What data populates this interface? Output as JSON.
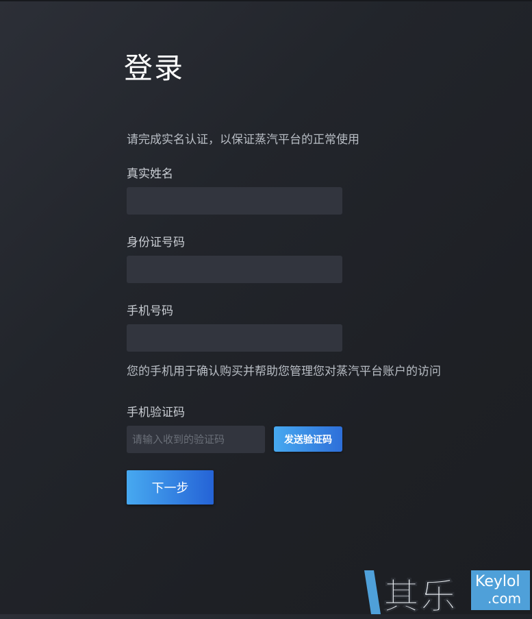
{
  "page": {
    "title": "登录",
    "instruction": "请完成实名认证，以保证蒸汽平台的正常使用"
  },
  "form": {
    "real_name": {
      "label": "真实姓名",
      "value": "",
      "placeholder": ""
    },
    "id_number": {
      "label": "身份证号码",
      "value": "",
      "placeholder": ""
    },
    "phone": {
      "label": "手机号码",
      "value": "",
      "placeholder": "",
      "help": "您的手机用于确认购买并帮助您管理您对蒸汽平台账户的访问"
    },
    "verification_code": {
      "label": "手机验证码",
      "value": "",
      "placeholder": "请输入收到的验证码",
      "send_button": "发送验证码"
    },
    "next_button": "下一步"
  },
  "watermark": {
    "cn_text": "其乐",
    "en_text": "Keylol",
    "domain_text": ".com"
  },
  "colors": {
    "background": "#1e2025",
    "input_bg": "#32353e",
    "accent_start": "#47a9f0",
    "accent_end": "#2563d6",
    "watermark_blue": "#4fa0d9"
  }
}
